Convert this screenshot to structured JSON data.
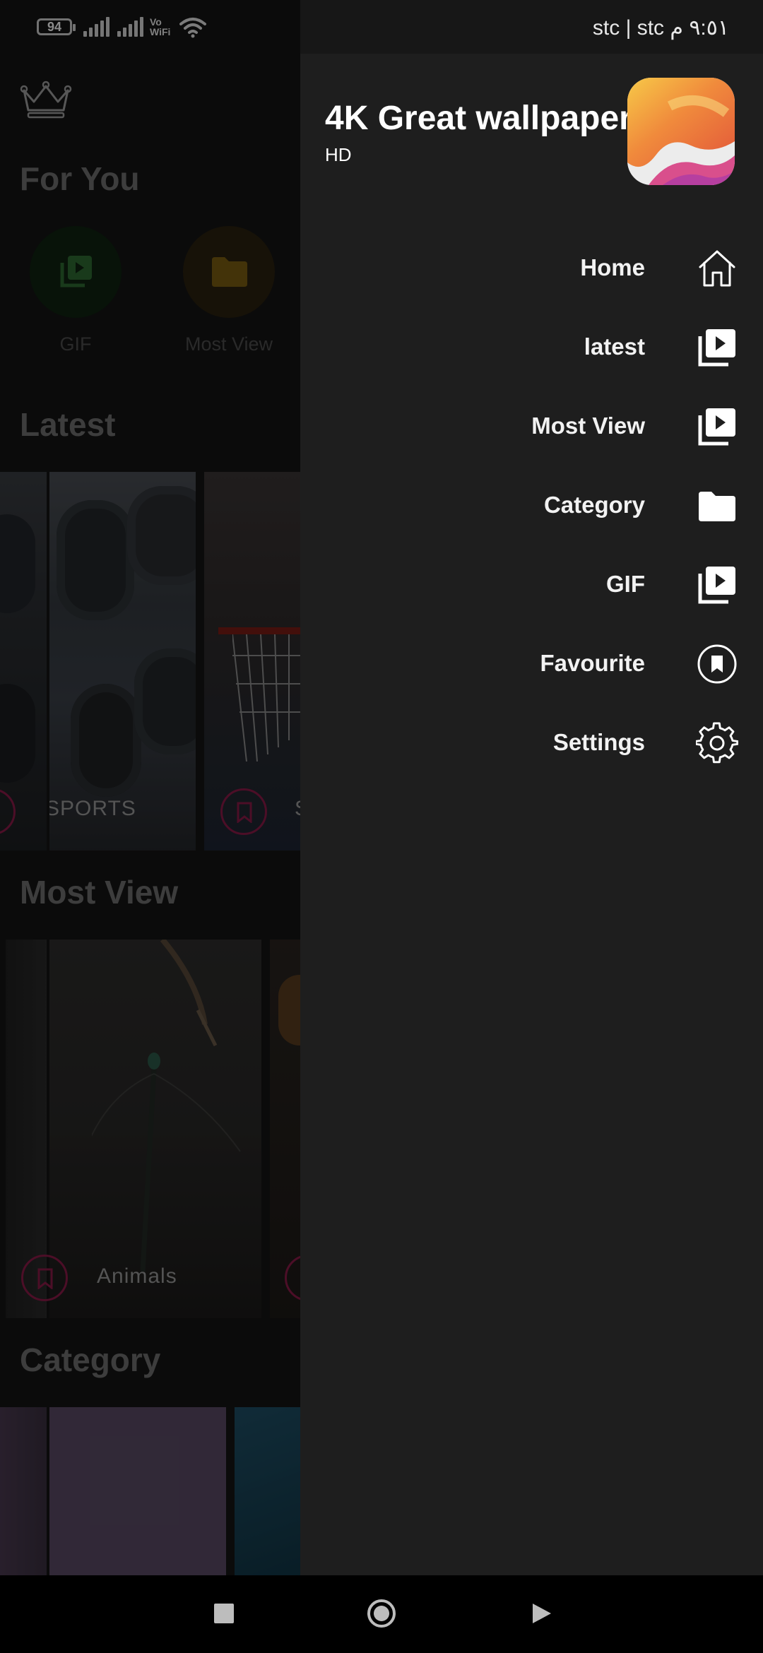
{
  "status_bar": {
    "battery": "94",
    "vowifi_top": "Vo",
    "vowifi_bottom": "WiFi",
    "right_text": "stc | stc ٩:٥١ م"
  },
  "background": {
    "for_you_title": "For You",
    "for_you_items": [
      {
        "label": "GIF",
        "icon": "play-stack-icon",
        "color": "#2e7d32"
      },
      {
        "label": "Most View",
        "icon": "folder-icon",
        "color": "#f9a825"
      }
    ],
    "latest_title": "Latest",
    "latest_cards": [
      {
        "label": "SPORTS"
      },
      {
        "label": "S"
      }
    ],
    "most_view_title": "Most View",
    "most_view_cards": [
      {
        "label": "Animals"
      }
    ],
    "category_title": "Category"
  },
  "drawer": {
    "app_name": "4K Great wallpaper",
    "app_subtitle": "HD",
    "menu": [
      {
        "label": "Home",
        "icon": "home-icon"
      },
      {
        "label": "latest",
        "icon": "play-stack-icon"
      },
      {
        "label": "Most View",
        "icon": "play-stack-icon"
      },
      {
        "label": "Category",
        "icon": "folder-icon"
      },
      {
        "label": "GIF",
        "icon": "play-stack-icon"
      },
      {
        "label": "Favourite",
        "icon": "bookmark-circle-icon"
      },
      {
        "label": "Settings",
        "icon": "gear-icon"
      }
    ]
  },
  "nav_bar": {
    "buttons": [
      "recents-button",
      "home-button",
      "back-button"
    ]
  },
  "colors": {
    "drawer_bg": "#1e1e1e",
    "accent_pink": "#c2185b",
    "gif_green": "#2e7d32",
    "folder_yellow": "#f9a825"
  }
}
